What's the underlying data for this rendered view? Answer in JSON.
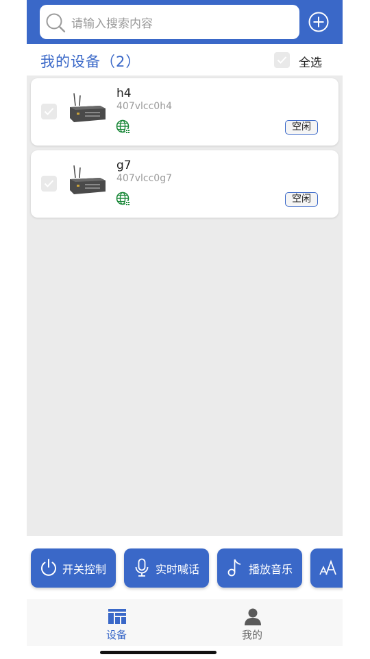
{
  "search": {
    "placeholder": "请输入搜索内容"
  },
  "header": {
    "title": "我的设备（2）",
    "select_all_label": "全选"
  },
  "devices": [
    {
      "name": "h4",
      "id": "407vlcc0h4",
      "status": "空闲"
    },
    {
      "name": "g7",
      "id": "407vlcc0g7",
      "status": "空闲"
    }
  ],
  "actions": [
    {
      "label": "开关控制",
      "icon": "power-icon"
    },
    {
      "label": "实时喊话",
      "icon": "microphone-icon"
    },
    {
      "label": "播放音乐",
      "icon": "music-note-icon"
    },
    {
      "label": "",
      "icon": "font-size-icon"
    }
  ],
  "tabs": [
    {
      "label": "设备",
      "icon": "devices-grid-icon",
      "active": true
    },
    {
      "label": "我的",
      "icon": "person-icon",
      "active": false
    }
  ],
  "colors": {
    "accent": "#3a68c8",
    "background": "#ebebeb",
    "online": "#1e8a3c"
  }
}
